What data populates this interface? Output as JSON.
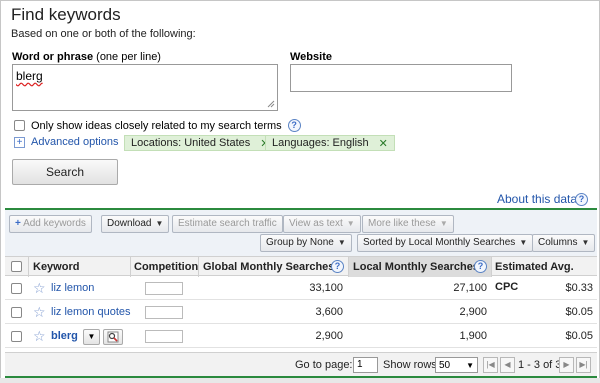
{
  "header": {
    "title": "Find keywords",
    "subtitle": "Based on one or both of the following:"
  },
  "form": {
    "phrase_label": "Word or phrase",
    "phrase_hint": "(one per line)",
    "phrase_value": "blerg",
    "website_label": "Website",
    "website_value": "",
    "only_ideas_label": "Only show ideas closely related to my search terms",
    "advanced_options": "Advanced options",
    "filters": [
      {
        "label": "Locations: United States"
      },
      {
        "label": "Languages: English"
      }
    ],
    "search_button": "Search"
  },
  "about_link": "About this data",
  "toolbar": {
    "add_keywords": "Add keywords",
    "download": "Download",
    "estimate": "Estimate search traffic",
    "view_as_text": "View as text",
    "more_like_these": "More like these",
    "group_by": "Group by None",
    "sorted_by": "Sorted by Local Monthly Searches",
    "columns": "Columns"
  },
  "table": {
    "headers": {
      "keyword": "Keyword",
      "competition": "Competition",
      "global": "Global Monthly Searches",
      "local": "Local Monthly Searches",
      "cpc": "Estimated Avg. CPC"
    },
    "rows": [
      {
        "keyword": "liz lemon",
        "global": "33,100",
        "local": "27,100",
        "cpc": "$0.33"
      },
      {
        "keyword": "liz lemon quotes",
        "global": "3,600",
        "local": "2,900",
        "cpc": "$0.05"
      },
      {
        "keyword": "blerg",
        "global": "2,900",
        "local": "1,900",
        "cpc": "$0.05"
      }
    ]
  },
  "footer": {
    "go_to_page": "Go to page:",
    "page_value": "1",
    "show_rows": "Show rows:",
    "rows_value": "50",
    "range": "1 - 3 of 3"
  },
  "colors": {
    "accent_green": "#2b8a3e",
    "link_blue": "#2255aa",
    "chip_bg": "#dff0d8"
  }
}
